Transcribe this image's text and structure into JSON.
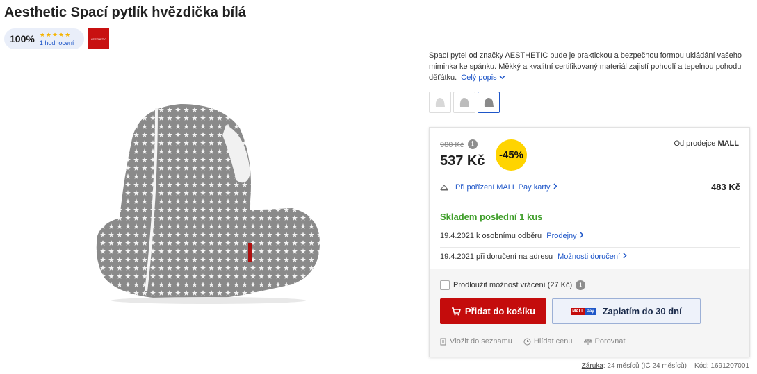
{
  "product": {
    "title": "Aesthetic Spací pytlík hvězdička bílá",
    "rating_percent": "100%",
    "rating_stars": "★★★★★",
    "rating_count": "1 hodnocení",
    "brand_logo_text": "AESTHETIC",
    "description": "Spací pytel od značky AESTHETIC bude je praktickou a bezpečnou formou ukládání vašeho miminka ke spánku. Měkký a kvalitní certifikovaný materiál zajistí pohodlí a tepelnou pohodu děťátku.",
    "description_more": "Celý popis"
  },
  "offer": {
    "old_price": "980 Kč",
    "price": "537 Kč",
    "discount": "-45%",
    "seller_prefix": "Od prodejce",
    "seller_name": "MALL",
    "mallpay_link": "Při pořízení MALL Pay karty",
    "mallpay_price": "483 Kč",
    "stock": "Skladem poslední 1 kus",
    "delivery_pickup": "19.4.2021 k osobnímu odběru",
    "delivery_pickup_link": "Prodejny",
    "delivery_address": "19.4.2021 při doručení na adresu",
    "delivery_address_link": "Možnosti doručení",
    "extend_return": "Prodloužit možnost vrácení (27 Kč)",
    "add_to_cart": "Přidat do košíku",
    "pay_later": "Zaplatím do 30 dní",
    "mallpay_logo_mall": "MALL",
    "mallpay_logo_pay": "Pay",
    "watch_list": "Vložit do seznamu",
    "watch_price": "Hlídat cenu",
    "compare": "Porovnat"
  },
  "footer": {
    "warranty_label": "Záruka",
    "warranty_value": ": 24 měsíců (IČ 24 měsíců)",
    "code": "Kód: 1691207001"
  },
  "colors": {
    "accent_red": "#c40c0c",
    "link_blue": "#1e56c8",
    "stock_green": "#3f9e2a",
    "discount_yellow": "#ffd400"
  },
  "icons": [
    "chevron-down-icon",
    "chevron-right-icon",
    "info-icon",
    "card-icon",
    "cart-icon",
    "list-icon",
    "clock-icon",
    "scale-icon"
  ]
}
